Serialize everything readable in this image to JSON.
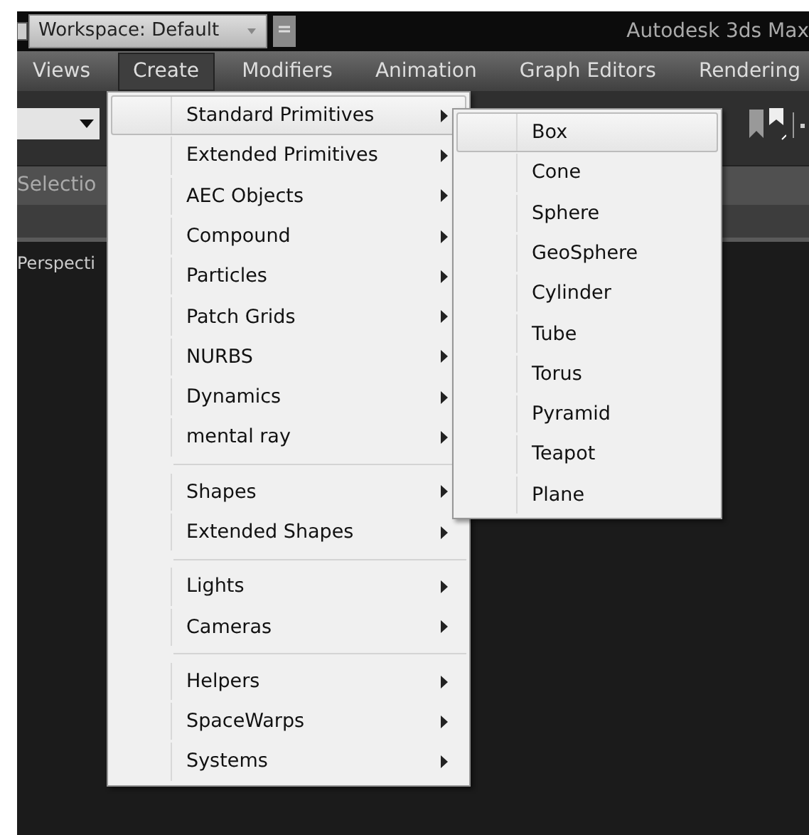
{
  "title_bar": {
    "workspace": "Workspace: Default",
    "title": "Autodesk 3ds Max"
  },
  "menu_bar": [
    {
      "label": "Views",
      "selected": false
    },
    {
      "label": "Create",
      "selected": true
    },
    {
      "label": "Modifiers",
      "selected": false
    },
    {
      "label": "Animation",
      "selected": false
    },
    {
      "label": "Graph Editors",
      "selected": false
    },
    {
      "label": "Rendering",
      "selected": false
    }
  ],
  "panel_tab": "Selectio",
  "viewport_label": "Perspecti",
  "create_menu": [
    {
      "kind": "item",
      "label": "Standard Primitives",
      "selected": true
    },
    {
      "kind": "item",
      "label": "Extended Primitives",
      "selected": false
    },
    {
      "kind": "item",
      "label": "AEC Objects",
      "selected": false
    },
    {
      "kind": "item",
      "label": "Compound",
      "selected": false
    },
    {
      "kind": "item",
      "label": "Particles",
      "selected": false
    },
    {
      "kind": "item",
      "label": "Patch Grids",
      "selected": false
    },
    {
      "kind": "item",
      "label": "NURBS",
      "selected": false
    },
    {
      "kind": "item",
      "label": "Dynamics",
      "selected": false
    },
    {
      "kind": "item",
      "label": "mental ray",
      "selected": false
    },
    {
      "kind": "separator"
    },
    {
      "kind": "item",
      "label": "Shapes",
      "selected": false
    },
    {
      "kind": "item",
      "label": "Extended Shapes",
      "selected": false
    },
    {
      "kind": "separator"
    },
    {
      "kind": "item",
      "label": "Lights",
      "selected": false
    },
    {
      "kind": "item",
      "label": "Cameras",
      "selected": false
    },
    {
      "kind": "separator"
    },
    {
      "kind": "item",
      "label": "Helpers",
      "selected": false
    },
    {
      "kind": "item",
      "label": "SpaceWarps",
      "selected": false
    },
    {
      "kind": "item",
      "label": "Systems",
      "selected": false
    }
  ],
  "submenu": [
    {
      "label": "Box",
      "selected": true
    },
    {
      "label": "Cone",
      "selected": false
    },
    {
      "label": "Sphere",
      "selected": false
    },
    {
      "label": "GeoSphere",
      "selected": false
    },
    {
      "label": "Cylinder",
      "selected": false
    },
    {
      "label": "Tube",
      "selected": false
    },
    {
      "label": "Torus",
      "selected": false
    },
    {
      "label": "Pyramid",
      "selected": false
    },
    {
      "label": "Teapot",
      "selected": false
    },
    {
      "label": "Plane",
      "selected": false
    }
  ]
}
